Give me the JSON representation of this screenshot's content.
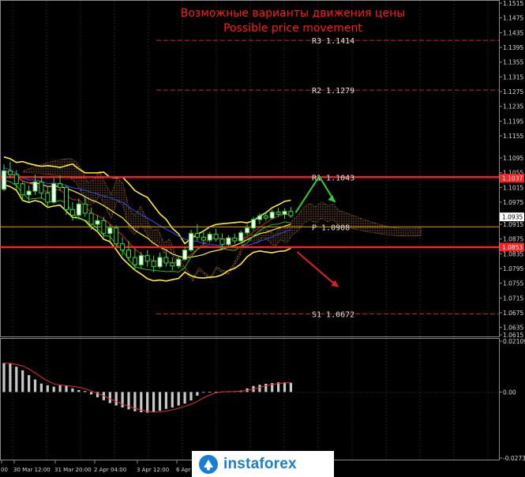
{
  "chart_data": [
    {
      "type": "candlestick",
      "title": "Возможные варианты движения цены",
      "subtitle": "Possible price movement",
      "title_color": "#ff1a1a",
      "ylim": [
        1.0615,
        1.1515
      ],
      "y_ticks": [
        "1.1515",
        "1.1475",
        "1.1435",
        "1.1395",
        "1.1355",
        "1.1315",
        "1.1275",
        "1.1235",
        "1.1195",
        "1.1155",
        "1.1095",
        "1.1055",
        "1.1015",
        "1.0975",
        "1.0935",
        "1.0915",
        "1.0875",
        "1.0855",
        "1.0835",
        "1.0795",
        "1.0755",
        "1.0715",
        "1.0675",
        "1.0635",
        "1.0615"
      ],
      "x_ticks": [
        "00",
        "30 Mar 12:00",
        "31 Mar 20:00",
        "2 Apr 04:00",
        "3 Apr 12:00",
        "6 Apr"
      ],
      "levels": [
        {
          "name": "R3",
          "label": "R3  1.1414",
          "value": 1.1414,
          "style": "dashed",
          "color": "#c82828"
        },
        {
          "name": "R2",
          "label": "R2  1.1279",
          "value": 1.1279,
          "style": "dashed",
          "color": "#c82828"
        },
        {
          "name": "R1",
          "label": "R1  1.1043",
          "value": 1.1043,
          "style": "solid",
          "color": "#ff2020"
        },
        {
          "name": "P",
          "label": "P  1.0908",
          "value": 1.0908,
          "style": "solid",
          "color": "#e0a020"
        },
        {
          "name": "S1",
          "label": "S1  1.0672",
          "value": 1.0672,
          "style": "dashed",
          "color": "#c82828"
        }
      ],
      "price_tags": [
        {
          "label": "1.1037",
          "value": 1.104,
          "bg": "#ff2020",
          "fg": "#ffffff"
        },
        {
          "label": "1.0935",
          "value": 1.0935,
          "bg": "#ffffff",
          "fg": "#000000"
        },
        {
          "label": "1.0853",
          "value": 1.0853,
          "bg": "#ff2020",
          "fg": "#ffffff"
        }
      ],
      "candles": [
        [
          1.101,
          1.1078,
          1.1005,
          1.106
        ],
        [
          1.106,
          1.1085,
          1.104,
          1.105
        ],
        [
          1.105,
          1.1062,
          1.101,
          1.1025
        ],
        [
          1.1025,
          1.103,
          1.098,
          1.0995
        ],
        [
          1.0995,
          1.102,
          1.0975,
          1.1005
        ],
        [
          1.1005,
          1.105,
          1.0995,
          1.103
        ],
        [
          1.103,
          1.1045,
          1.0985,
          1.1
        ],
        [
          1.1,
          1.1015,
          1.096,
          1.0975
        ],
        [
          1.0975,
          1.104,
          1.097,
          1.1025
        ],
        [
          1.1025,
          1.1048,
          1.1005,
          1.1015
        ],
        [
          1.1015,
          1.102,
          1.094,
          1.0955
        ],
        [
          1.0955,
          1.0975,
          1.0925,
          1.094
        ],
        [
          1.094,
          1.0985,
          1.093,
          1.097
        ],
        [
          1.097,
          1.099,
          1.0935,
          1.0945
        ],
        [
          1.0945,
          1.096,
          1.09,
          1.0915
        ],
        [
          1.0915,
          1.094,
          1.0895,
          1.0925
        ],
        [
          1.0925,
          1.0935,
          1.088,
          1.089
        ],
        [
          1.089,
          1.0915,
          1.087,
          1.0905
        ],
        [
          1.0905,
          1.0912,
          1.0855,
          1.0862
        ],
        [
          1.0862,
          1.088,
          1.083,
          1.0845
        ],
        [
          1.0845,
          1.087,
          1.0815,
          1.0825
        ],
        [
          1.0825,
          1.085,
          1.079,
          1.0805
        ],
        [
          1.0805,
          1.084,
          1.0795,
          1.083
        ],
        [
          1.083,
          1.0845,
          1.08,
          1.0815
        ],
        [
          1.0815,
          1.083,
          1.0785,
          1.08
        ],
        [
          1.08,
          1.0838,
          1.0795,
          1.0825
        ],
        [
          1.0825,
          1.084,
          1.08,
          1.081
        ],
        [
          1.081,
          1.0825,
          1.079,
          1.0802
        ],
        [
          1.0802,
          1.083,
          1.0795,
          1.082
        ],
        [
          1.082,
          1.0855,
          1.0815,
          1.0845
        ],
        [
          1.0845,
          1.09,
          1.084,
          1.089
        ],
        [
          1.089,
          1.0915,
          1.087,
          1.088
        ],
        [
          1.088,
          1.09,
          1.086,
          1.0872
        ],
        [
          1.0872,
          1.0895,
          1.0865,
          1.0888
        ],
        [
          1.0888,
          1.0902,
          1.0868,
          1.0875
        ],
        [
          1.0875,
          1.089,
          1.085,
          1.086
        ],
        [
          1.086,
          1.0885,
          1.0855,
          1.0878
        ],
        [
          1.0878,
          1.089,
          1.0862,
          1.087
        ],
        [
          1.087,
          1.0898,
          1.0866,
          1.0892
        ],
        [
          1.0892,
          1.0915,
          1.0885,
          1.0905
        ],
        [
          1.0905,
          1.0935,
          1.0898,
          1.0928
        ],
        [
          1.0928,
          1.0945,
          1.0915,
          1.0938
        ],
        [
          1.0938,
          1.095,
          1.0925,
          1.0932
        ],
        [
          1.0932,
          1.0955,
          1.0928,
          1.0948
        ],
        [
          1.0948,
          1.096,
          1.0935,
          1.0942
        ],
        [
          1.0942,
          1.0958,
          1.093,
          1.095
        ],
        [
          1.095,
          1.0962,
          1.0932,
          1.0938
        ]
      ],
      "arrows": [
        {
          "direction": "up",
          "color": "#2fd12f"
        },
        {
          "direction": "down",
          "color": "#e02020"
        }
      ]
    },
    {
      "type": "histogram",
      "y_ticks": [
        "0.02109",
        "0.00",
        "-0.02739"
      ],
      "ylim": [
        -0.02739,
        0.02109
      ],
      "bars": [
        0.012,
        0.0118,
        0.0105,
        0.009,
        0.007,
        0.0052,
        0.0035,
        0.0028,
        0.0022,
        0.003,
        0.0026,
        0.0015,
        0.0008,
        0.0004,
        -0.001,
        -0.0022,
        -0.0034,
        -0.0046,
        -0.0056,
        -0.0064,
        -0.0072,
        -0.008,
        -0.0084,
        -0.0086,
        -0.0082,
        -0.0078,
        -0.007,
        -0.0064,
        -0.0056,
        -0.0048,
        -0.0035,
        -0.0015,
        0.0,
        0.0001,
        0.0001,
        0.0002,
        0.0002,
        0.0003,
        0.0006,
        0.0015,
        0.0025,
        0.003,
        0.0034,
        0.0037,
        0.004,
        0.004,
        0.0038
      ],
      "signal_color": "#e03030",
      "bar_color": "#c8c8c8"
    }
  ],
  "watermark": {
    "text": "instaforex"
  }
}
